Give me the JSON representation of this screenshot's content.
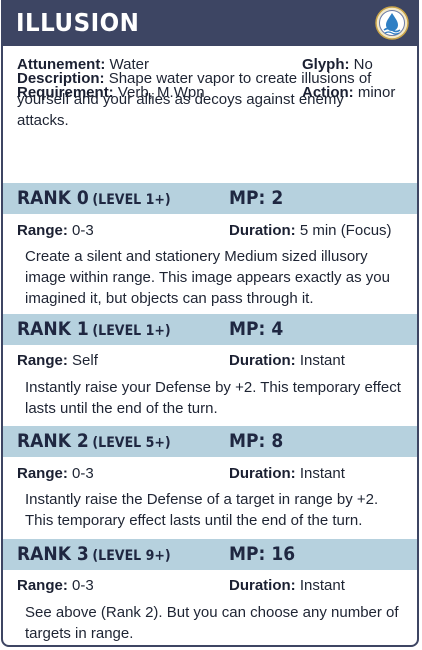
{
  "card": {
    "title": "ILLUSION",
    "emblem_icon": "water-drop-emblem-icon",
    "attunement_label": "Attunement:",
    "attunement_value": "Water",
    "glyph_label": "Glyph:",
    "glyph_value": "No",
    "requirement_label": "Requirement:",
    "requirement_value": "Verb, M.Wpn",
    "action_label": "Action:",
    "action_value": "minor",
    "description_label": "Description:",
    "description_value": "Shape water vapor to create illusions of yourself and your allies as decoys against enemy attacks.",
    "colors": {
      "header": "#3d4563",
      "rank_band": "#b6d1de",
      "text": "#1e2433"
    }
  },
  "ranks": [
    {
      "title": "RANK 0",
      "level": "(LEVEL 1+)",
      "mp": "MP: 2",
      "range_label": "Range:",
      "range_value": "0-3",
      "duration_label": "Duration:",
      "duration_value": "5 min (Focus)",
      "text": "Create a silent and stationery Medium sized illusory image within range. This image appears exactly as you imagined it, but objects can pass through it."
    },
    {
      "title": "RANK 1",
      "level": "(LEVEL 1+)",
      "mp": "MP: 4",
      "range_label": "Range:",
      "range_value": "Self",
      "duration_label": "Duration:",
      "duration_value": "Instant",
      "text": "Instantly raise your Defense by +2. This temporary effect lasts until the end of the turn."
    },
    {
      "title": "RANK 2",
      "level": "(LEVEL 5+)",
      "mp": "MP: 8",
      "range_label": "Range:",
      "range_value": "0-3",
      "duration_label": "Duration:",
      "duration_value": "Instant",
      "text": "Instantly raise the Defense of a target in range by +2. This temporary effect lasts until the end of the turn."
    },
    {
      "title": "RANK 3",
      "level": "(LEVEL 9+)",
      "mp": "MP: 16",
      "range_label": "Range:",
      "range_value": "0-3",
      "duration_label": "Duration:",
      "duration_value": "Instant",
      "text": "See above (Rank 2). But you can choose any number of targets in range."
    }
  ]
}
